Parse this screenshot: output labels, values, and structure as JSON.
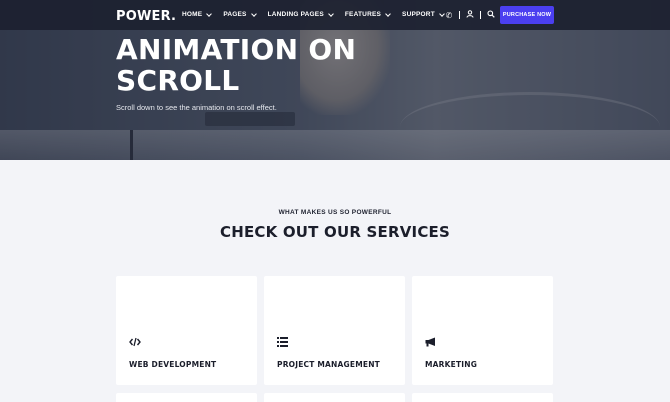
{
  "brand": {
    "logo": "POWER."
  },
  "nav": {
    "items": [
      {
        "label": "HOME"
      },
      {
        "label": "PAGES"
      },
      {
        "label": "LANDING PAGES"
      },
      {
        "label": "FEATURES"
      },
      {
        "label": "SUPPORT"
      }
    ],
    "icons": [
      "phone-icon",
      "user-icon",
      "search-icon"
    ],
    "cta": "PURCHASE NOW",
    "accent": "#4b3ff0"
  },
  "hero": {
    "title_line1": "ANIMATION ON",
    "title_line2": "SCROLL",
    "subtitle": "Scroll down to see the animation on scroll effect."
  },
  "services": {
    "eyebrow": "WHAT MAKES US SO POWERFUL",
    "heading": "CHECK OUT OUR SERVICES",
    "cards": [
      {
        "icon": "code-icon",
        "title": "WEB DEVELOPMENT"
      },
      {
        "icon": "list-icon",
        "title": "PROJECT MANAGEMENT"
      },
      {
        "icon": "megaphone-icon",
        "title": "MARKETING"
      }
    ]
  }
}
